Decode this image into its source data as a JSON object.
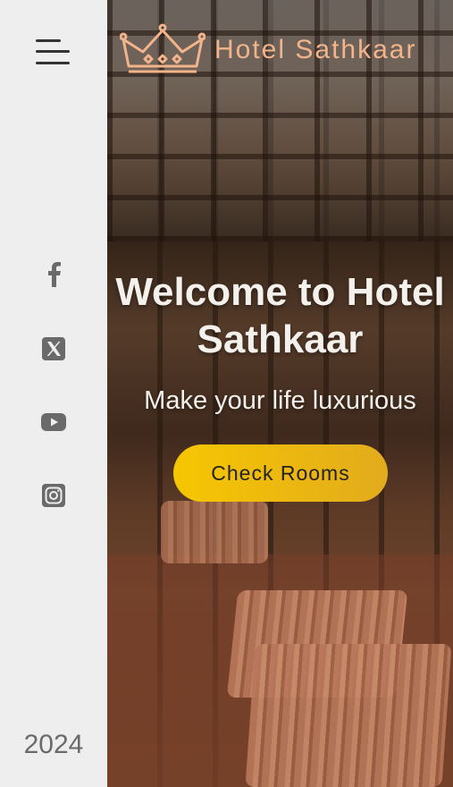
{
  "brand": {
    "name": "Hotel Sathkaar",
    "logo_icon": "crown-icon",
    "accent": "#f2b48a"
  },
  "hero": {
    "headline": "Welcome to Hotel Sathkaar",
    "tagline": "Make your life luxurious",
    "cta_label": "Check Rooms",
    "cta_color": "#f7c600"
  },
  "sidebar": {
    "menu_icon": "hamburger-menu-icon",
    "social": [
      {
        "name": "facebook-icon"
      },
      {
        "name": "x-twitter-icon"
      },
      {
        "name": "youtube-icon"
      },
      {
        "name": "instagram-icon"
      }
    ],
    "year": "2024"
  }
}
